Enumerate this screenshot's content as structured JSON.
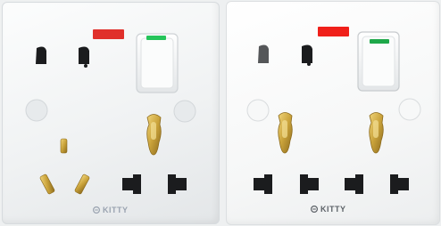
{
  "left_plate": {
    "brand": "KITTY",
    "indicator_color": "#e0302b",
    "switch_led_color": "#25c45a"
  },
  "right_plate": {
    "brand": "KITTY",
    "indicator_color": "#f0201a",
    "switch_led_color": "#1ea84a"
  },
  "colors": {
    "plug_hole": "#1b1c1e",
    "brass": "#c9a23a",
    "pin_hole_grey": "#eef0f1"
  }
}
